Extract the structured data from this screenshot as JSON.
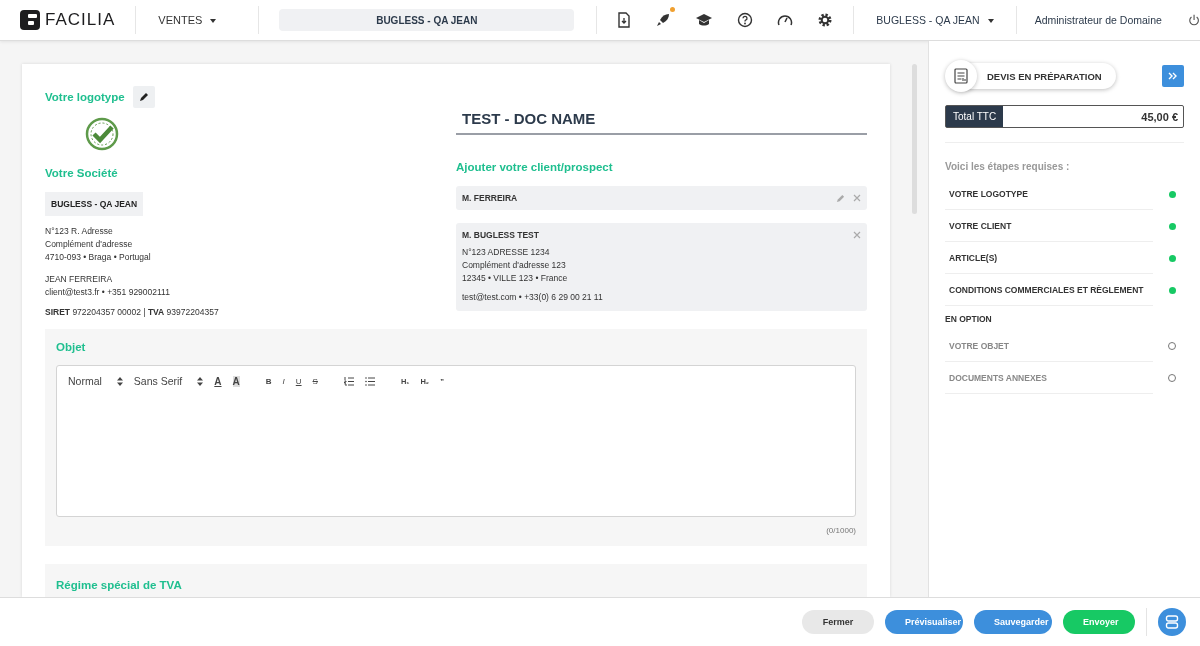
{
  "topbar": {
    "logo": "FACILIA",
    "module": "VENTES",
    "company_field": "BUGLESS - QA JEAN",
    "notification": true,
    "account": "BUGLESS - QA JEAN",
    "user": "Administrateur de Domaine"
  },
  "document": {
    "logo_label": "Votre logotype",
    "title": "TEST - DOC NAME",
    "company_label": "Votre Société",
    "company": "BUGLESS - QA JEAN",
    "company_address": [
      "N°123 R. Adresse",
      "Complément d'adresse",
      "4710-093 • Braga • Portugal"
    ],
    "company_contact": [
      "JEAN FERREIRA",
      "client@test3.fr • +351 929002111"
    ],
    "company_ids": "**SIRET** 972204357 00002 | **TVA** 93972204357",
    "client_label": "Ajouter votre client/prospect",
    "contact": "M. FERREIRA",
    "client": "M. BUGLESS TEST",
    "client_address": [
      "N°123 ADRESSE 1234",
      "Complément d'adresse 123",
      "12345 • VILLE 123 • France"
    ],
    "client_contact": "test@test.com • +33(0) 6 29 00 21 11",
    "object_label": "Objet",
    "format": "Normal",
    "font": "Sans Serif",
    "format_buttons": [
      {
        "kind": "bold",
        "label": "B"
      },
      {
        "kind": "italic",
        "label": "I"
      },
      {
        "kind": "underline",
        "label": "U"
      },
      {
        "kind": "strike",
        "label": "S"
      }
    ],
    "heading_buttons": [
      "H₁",
      "H₂",
      "”"
    ],
    "text_color_label": "A",
    "highlight_label": "A",
    "counter": "(0/1000)",
    "vat_label": "Régime spécial de TVA"
  },
  "panel": {
    "status": "DEVIS EN PRÉPARATION",
    "total_label": "Total TTC",
    "total": "45,00 €",
    "steps_title": "Voici les étapes requises :",
    "steps": [
      {
        "label": "VOTRE LOGOTYPE",
        "done": true
      },
      {
        "label": "VOTRE CLIENT",
        "done": true
      },
      {
        "label": "ARTICLE(S)",
        "done": true
      },
      {
        "label": "CONDITIONS COMMERCIALES ET RÈGLEMENT",
        "done": true
      }
    ],
    "options_title": "EN OPTION",
    "options": [
      {
        "label": "VOTRE OBJET",
        "done": false
      },
      {
        "label": "DOCUMENTS ANNEXES",
        "done": false
      }
    ]
  },
  "footer": [
    {
      "kind": "close",
      "label": "Fermer"
    },
    {
      "kind": "primary",
      "label": "Prévisualiser"
    },
    {
      "kind": "primary",
      "label": "Sauvegarder"
    },
    {
      "kind": "send",
      "label": "Envoyer"
    }
  ]
}
